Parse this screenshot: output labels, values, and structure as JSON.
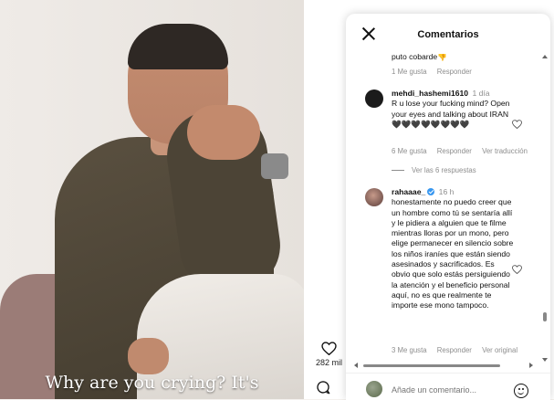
{
  "video": {
    "caption": "Why are you crying? It's",
    "like_count": "282 mil"
  },
  "panel": {
    "title": "Comentarios",
    "like_label": "Me gusta",
    "reply_label": "Responder",
    "comments": [
      {
        "text": "puto cobarde👎",
        "likes": "1 Me gusta"
      },
      {
        "user": "mehdi_hashemi1610",
        "time": "1 día",
        "text": "R u lose your fucking mind? Open your eyes and talking about IRAN 🖤🖤🖤🖤🖤🖤🖤🖤",
        "likes": "6 Me gusta",
        "translate": "Ver traducción",
        "replies": "Ver las 6 respuestas"
      },
      {
        "user": "rahaaae_",
        "time": "16 h",
        "text": "honestamente no puedo creer que un hombre como tú se sentaría allí y le pidiera a alguien que te filme mientras lloras por un mono, pero elige permanecer en silencio sobre los niños iraníes que están siendo asesinados y sacrificados. Es obvio que solo estás persiguiendo la atención y el beneficio personal aquí, no es que realmente te importe ese mono tampoco.",
        "likes": "3 Me gusta",
        "original": "Ver original"
      }
    ],
    "input_placeholder": "Añade un comentario..."
  },
  "colors": {
    "verified": "#3897f0",
    "meta": "#8e8e8e"
  }
}
